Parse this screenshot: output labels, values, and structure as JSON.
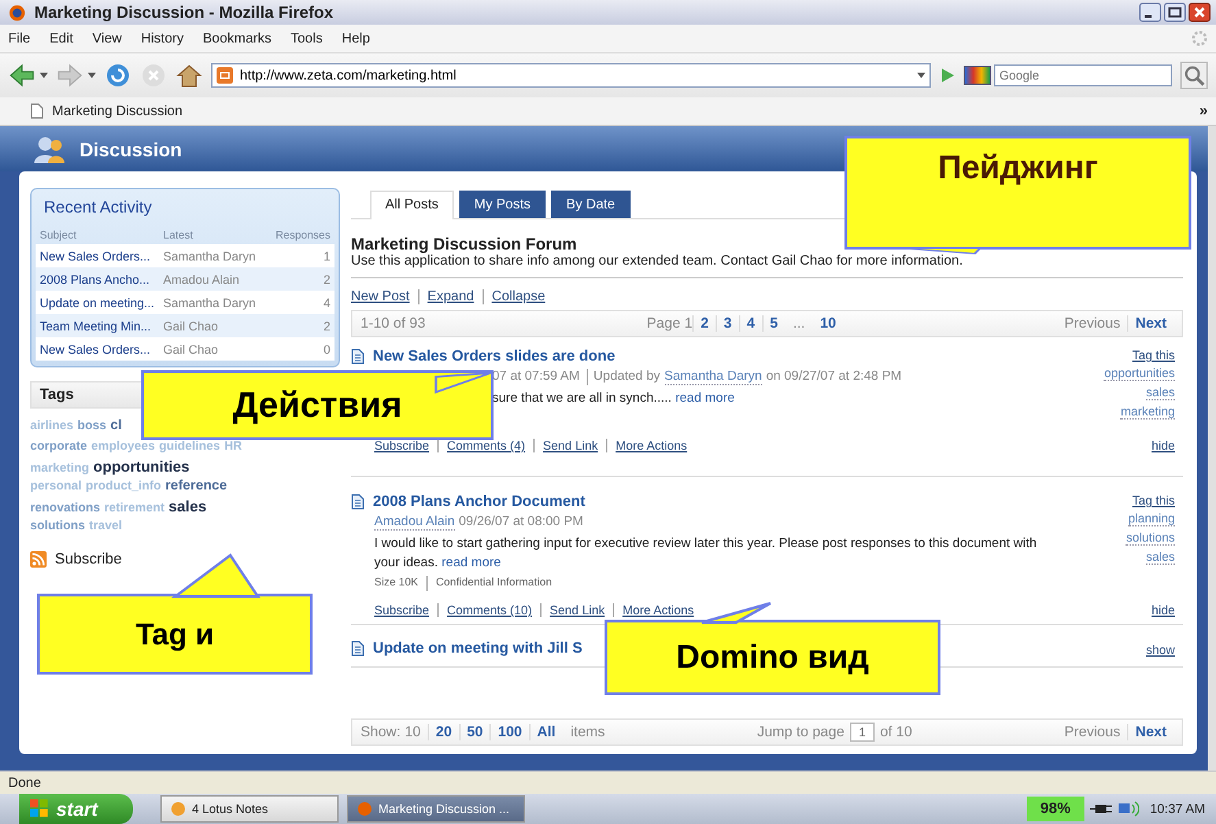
{
  "window": {
    "title": "Marketing Discussion - Mozilla Firefox"
  },
  "menu": [
    "File",
    "Edit",
    "View",
    "History",
    "Bookmarks",
    "Tools",
    "Help"
  ],
  "navbar": {
    "url": "http://www.zeta.com/marketing.html",
    "search": {
      "placeholder": "Google"
    }
  },
  "browser_tab": {
    "label": "Marketing Discussion",
    "overflow": "»"
  },
  "app_header": {
    "title": "Discussion"
  },
  "recent_activity": {
    "title": "Recent Activity",
    "columns": [
      "Subject",
      "Latest",
      "Responses"
    ],
    "rows": [
      {
        "subject": "New Sales Orders...",
        "latest": "Samantha Daryn",
        "responses": "1"
      },
      {
        "subject": "2008 Plans Ancho...",
        "latest": "Amadou Alain",
        "responses": "2"
      },
      {
        "subject": "Update on meeting...",
        "latest": "Samantha Daryn",
        "responses": "4"
      },
      {
        "subject": "Team Meeting Min...",
        "latest": "Gail Chao",
        "responses": "2"
      },
      {
        "subject": "New Sales Orders...",
        "latest": "Gail Chao",
        "responses": "0"
      }
    ]
  },
  "tags": {
    "title": "Tags",
    "lines": [
      [
        {
          "label": "airlines",
          "kind": "light"
        },
        {
          "label": "boss",
          "kind": "medium"
        },
        {
          "label": "cl",
          "kind": "strong"
        }
      ],
      [
        {
          "label": "corporate",
          "kind": "medium"
        },
        {
          "label": "employees",
          "kind": "light"
        },
        {
          "label": "guidelines",
          "kind": "light"
        },
        {
          "label": "HR",
          "kind": "light"
        }
      ],
      [
        {
          "label": "marketing",
          "kind": "light"
        },
        {
          "label": "opportunities",
          "kind": "big"
        }
      ],
      [
        {
          "label": "personal",
          "kind": "light"
        },
        {
          "label": "product_info",
          "kind": "light"
        },
        {
          "label": "reference",
          "kind": "strong"
        }
      ],
      [
        {
          "label": "renovations",
          "kind": "medium"
        },
        {
          "label": "retirement",
          "kind": "light"
        },
        {
          "label": "sales",
          "kind": "big"
        }
      ],
      [
        {
          "label": "solutions",
          "kind": "medium"
        },
        {
          "label": "travel",
          "kind": "light"
        }
      ]
    ]
  },
  "subscribe": "Subscribe",
  "tabs": [
    {
      "label": "All Posts",
      "selected": true
    },
    {
      "label": "My Posts",
      "selected": false
    },
    {
      "label": "By Date",
      "selected": false
    }
  ],
  "forum": {
    "title": "Marketing Discussion Forum",
    "description": "Use this application to share info among our extended team. Contact Gail Chao for more information.",
    "actions": [
      "New Post",
      "Expand",
      "Collapse"
    ]
  },
  "pager": {
    "range": "1-10 of 93",
    "current": "Page 1",
    "pages": [
      "2",
      "3",
      "4",
      "5"
    ],
    "ellipsis": "...",
    "last": "10",
    "previous": "Previous",
    "next": "Next"
  },
  "posts": [
    {
      "title": "New Sales Orders slides are done",
      "expanded": true,
      "date": "07 at 07:59 AM",
      "updated_label": "Updated by",
      "updated_by": "Samantha Daryn",
      "updated_date": "on 09/27/07 at 2:48 PM",
      "body": "sure that we are all in synch.....",
      "read_more": "read more",
      "actions": [
        "Subscribe",
        "Comments (4)",
        "Send Link",
        "More Actions"
      ],
      "tag_this": "Tag this",
      "tags": [
        "opportunities",
        "sales",
        "marketing"
      ],
      "toggle": "hide"
    },
    {
      "title": "2008 Plans Anchor Document",
      "expanded": true,
      "author": "Amadou Alain",
      "date": "09/26/07 at 08:00 PM",
      "body": "I would like to start gathering input for executive review later this year. Please post responses to this document with your ideas.",
      "read_more": "read more",
      "meta": [
        "Size 10K",
        "Confidential Information"
      ],
      "actions": [
        "Subscribe",
        "Comments (10)",
        "Send Link",
        "More Actions"
      ],
      "tag_this": "Tag this",
      "tags": [
        "planning",
        "solutions",
        "sales"
      ],
      "toggle": "hide"
    },
    {
      "title": "Update on meeting with Jill S",
      "expanded": false,
      "toggle": "show"
    }
  ],
  "footer": {
    "show_label": "Show:",
    "current": "10",
    "options": [
      "20",
      "50",
      "100",
      "All"
    ],
    "items_label": "items",
    "jump_label": "Jump to page",
    "jump_value": "1",
    "of_label": "of 10",
    "previous": "Previous",
    "next": "Next"
  },
  "status_bar": "Done",
  "taskbar": {
    "start": "start",
    "tasks": [
      {
        "label": "4 Lotus Notes",
        "selected": false
      },
      {
        "label": "Marketing Discussion ...",
        "selected": true
      }
    ],
    "battery": "98%",
    "time": "10:37 AM"
  },
  "callouts": [
    {
      "text": "Пейджинг"
    },
    {
      "text": "Действия"
    },
    {
      "text": "Tag и"
    },
    {
      "text": "Domino вид"
    }
  ]
}
